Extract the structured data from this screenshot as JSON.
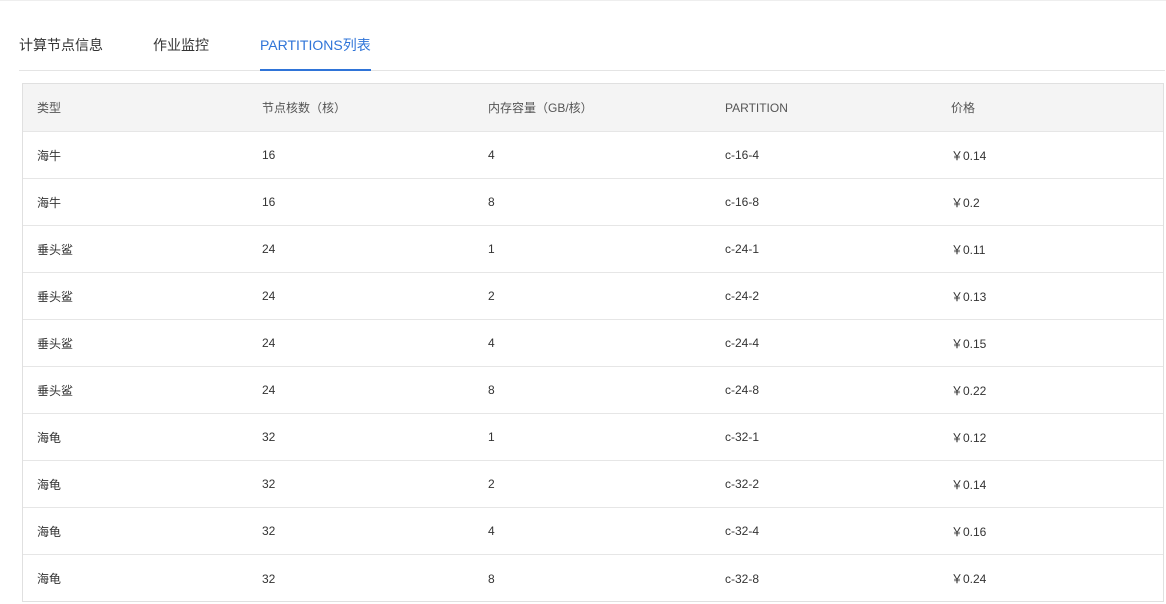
{
  "tabs": [
    {
      "label": "计算节点信息",
      "active": false
    },
    {
      "label": "作业监控",
      "active": false
    },
    {
      "label": "PARTITIONS列表",
      "active": true
    }
  ],
  "accent_color": "#2f74d8",
  "table": {
    "columns": [
      "类型",
      "节点核数（核）",
      "内存容量（GB/核）",
      "PARTITION",
      "价格"
    ],
    "rows": [
      [
        "海牛",
        "16",
        "4",
        "c-16-4",
        "￥0.14"
      ],
      [
        "海牛",
        "16",
        "8",
        "c-16-8",
        "￥0.2"
      ],
      [
        "垂头鲨",
        "24",
        "1",
        "c-24-1",
        "￥0.11"
      ],
      [
        "垂头鲨",
        "24",
        "2",
        "c-24-2",
        "￥0.13"
      ],
      [
        "垂头鲨",
        "24",
        "4",
        "c-24-4",
        "￥0.15"
      ],
      [
        "垂头鲨",
        "24",
        "8",
        "c-24-8",
        "￥0.22"
      ],
      [
        "海龟",
        "32",
        "1",
        "c-32-1",
        "￥0.12"
      ],
      [
        "海龟",
        "32",
        "2",
        "c-32-2",
        "￥0.14"
      ],
      [
        "海龟",
        "32",
        "4",
        "c-32-4",
        "￥0.16"
      ],
      [
        "海龟",
        "32",
        "8",
        "c-32-8",
        "￥0.24"
      ]
    ]
  }
}
